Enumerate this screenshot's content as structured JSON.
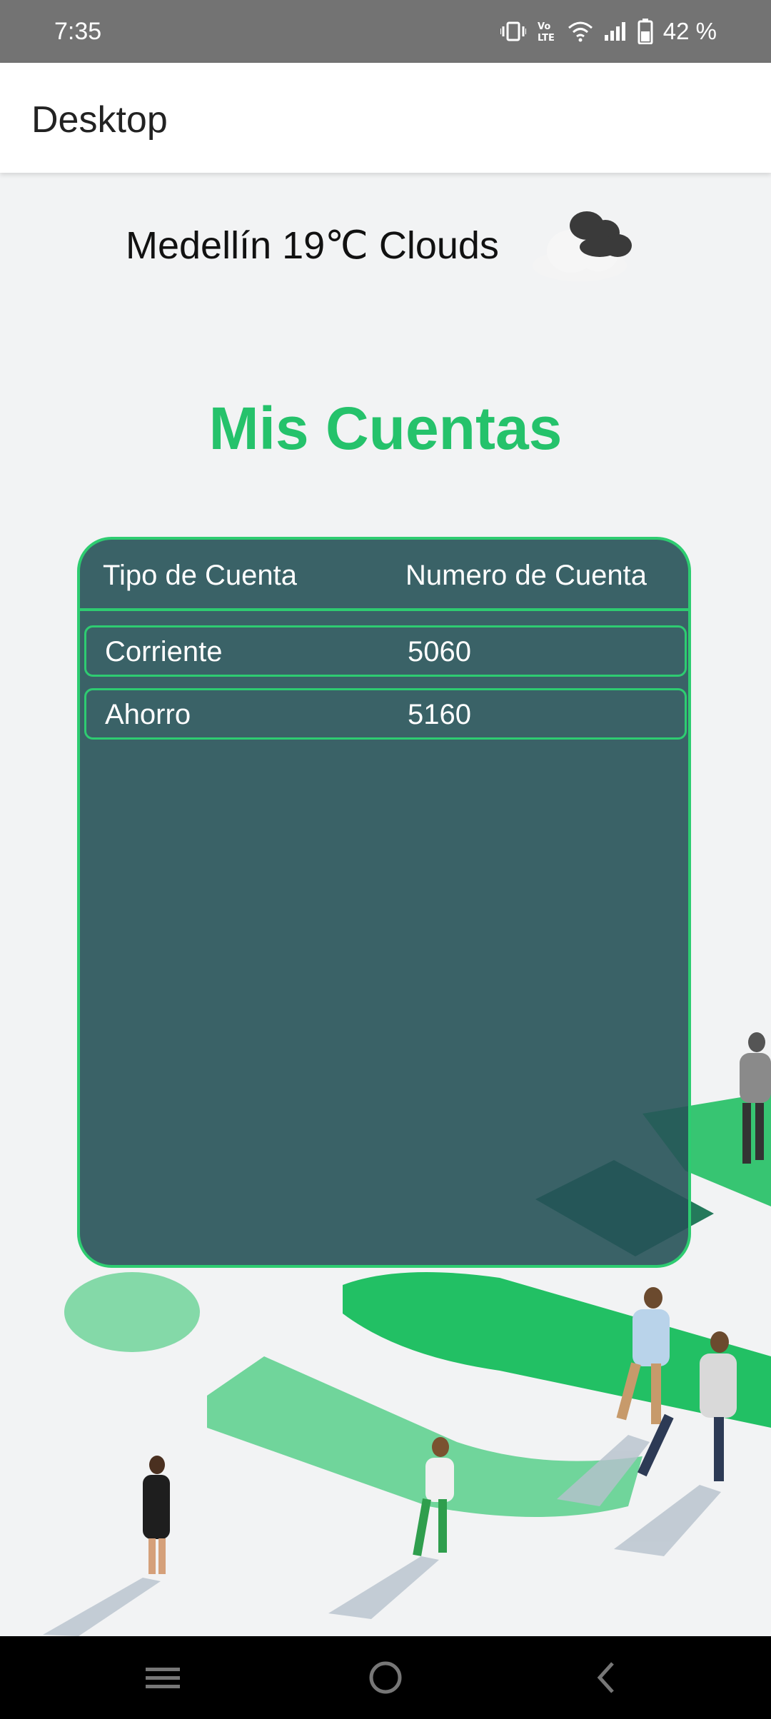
{
  "status_bar": {
    "time": "7:35",
    "battery_percent": "42 %",
    "icons": [
      "vibrate-icon",
      "volte-icon",
      "wifi-icon",
      "signal-icon",
      "battery-icon"
    ]
  },
  "app_bar": {
    "title": "Desktop"
  },
  "weather": {
    "text": "Medellín 19℃ Clouds",
    "icon": "clouds-icon"
  },
  "heading": "Mis Cuentas",
  "accounts_table": {
    "headers": [
      "Tipo de Cuenta",
      "Numero de Cuenta"
    ],
    "rows": [
      [
        "Corriente",
        "5060"
      ],
      [
        "Ahorro",
        "5160"
      ]
    ]
  },
  "nav_bar": {
    "buttons": [
      "menu-icon",
      "home-icon",
      "back-icon"
    ]
  },
  "colors": {
    "accent": "#25c26b",
    "card": "#265258",
    "status_bar": "#737373"
  }
}
